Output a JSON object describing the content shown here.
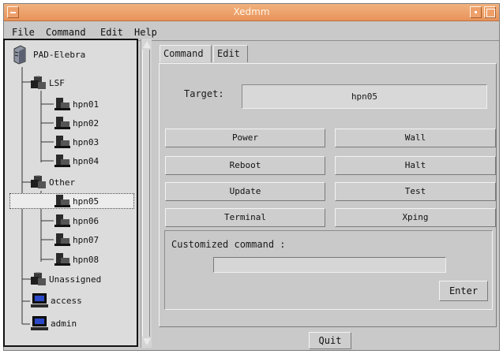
{
  "window": {
    "title": "Xedmm"
  },
  "menu": {
    "items": [
      "File",
      "Command",
      "Edit",
      "Help"
    ]
  },
  "tree": {
    "root": "PAD-Elebra",
    "groups": [
      {
        "label": "LSF",
        "children": [
          "hpn01",
          "hpn02",
          "hpn03",
          "hpn04"
        ]
      },
      {
        "label": "Other",
        "children": [
          "hpn05",
          "hpn06",
          "hpn07",
          "hpn08"
        ]
      },
      {
        "label": "Unassigned",
        "children": []
      }
    ],
    "hosts": [
      "access",
      "admin"
    ],
    "selected": "hpn05"
  },
  "tabs": [
    "Command",
    "Edit"
  ],
  "command_panel": {
    "target_label": "Target:",
    "target_value": "hpn05",
    "buttons": [
      "Power",
      "Wall",
      "Reboot",
      "Halt",
      "Update",
      "Test",
      "Terminal",
      "Xping"
    ],
    "custom_label": "Customized command :",
    "custom_value": "",
    "enter_label": "Enter"
  },
  "footer": {
    "quit_label": "Quit"
  }
}
